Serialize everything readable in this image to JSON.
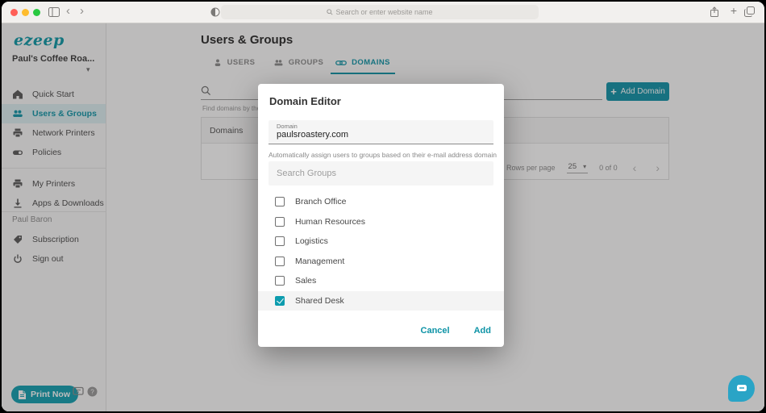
{
  "browser": {
    "address_placeholder": "Search or enter website name"
  },
  "icons": {
    "plus": "+",
    "caret_down": "▾",
    "chevron_left": "‹",
    "chevron_right": "›",
    "back": "‹",
    "forward": "›",
    "new_tab": "+"
  },
  "sidebar": {
    "logo_text": "ezeep",
    "account_name": "Paul's Coffee Roa...",
    "items": [
      {
        "label": "Quick Start"
      },
      {
        "label": "Users & Groups"
      },
      {
        "label": "Network Printers"
      },
      {
        "label": "Policies"
      },
      {
        "label": "My Printers"
      },
      {
        "label": "Apps & Downloads"
      }
    ],
    "user_section": {
      "name": "Paul Baron",
      "items": [
        {
          "label": "Subscription"
        },
        {
          "label": "Sign out"
        }
      ]
    },
    "print_now_label": "Print Now"
  },
  "main": {
    "title": "Users & Groups",
    "tabs": [
      {
        "label": "USERS"
      },
      {
        "label": "GROUPS"
      },
      {
        "label": "DOMAINS"
      }
    ],
    "search_helper": "Find domains by their",
    "add_domain_label": "Add Domain",
    "table": {
      "header": "Domains"
    },
    "pagination": {
      "rows_per_page_label": "Rows per page",
      "rows_per_page_value": "25",
      "range_text": "0 of 0"
    }
  },
  "modal": {
    "title": "Domain Editor",
    "domain_field": {
      "label": "Domain",
      "value": "paulsroastery.com"
    },
    "helper_text": "Automatically assign users to groups based on their e-mail address domain",
    "groups_search_placeholder": "Search Groups",
    "groups": [
      {
        "name": "Branch Office",
        "checked": false
      },
      {
        "name": "Human Resources",
        "checked": false
      },
      {
        "name": "Logistics",
        "checked": false
      },
      {
        "name": "Management",
        "checked": false
      },
      {
        "name": "Sales",
        "checked": false
      },
      {
        "name": "Shared Desk",
        "checked": true
      }
    ],
    "cancel_label": "Cancel",
    "add_label": "Add"
  },
  "colors": {
    "accent": "#1196a8",
    "active_item_bg": "#ddf0f3",
    "fab": "#2aa4c6",
    "checked_checkbox": "#0d9cae"
  }
}
